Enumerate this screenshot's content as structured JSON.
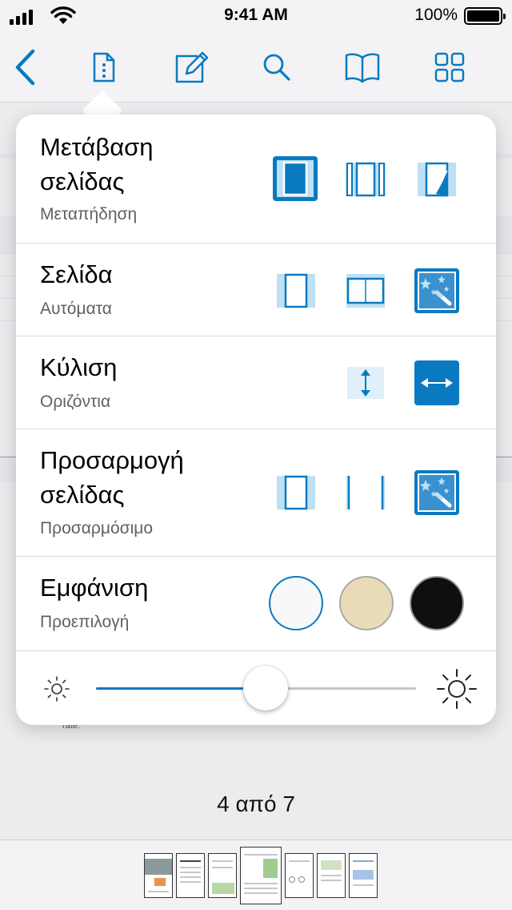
{
  "status_bar": {
    "time": "9:41 AM",
    "battery_percent": "100%",
    "battery_level": 1.0,
    "signal_bars": 4
  },
  "toolbar": {
    "items": [
      {
        "name": "back-chevron-icon"
      },
      {
        "name": "document-options-icon"
      },
      {
        "name": "annotate-pencil-icon"
      },
      {
        "name": "search-icon"
      },
      {
        "name": "bookmarks-book-icon"
      },
      {
        "name": "grid-view-icon"
      }
    ],
    "accent_color": "#0a7ac0"
  },
  "settings": {
    "transition": {
      "title_line1": "Μετάβαση",
      "title_line2": "σελίδας",
      "value": "Μεταπήδηση",
      "options": [
        "jump-transition-icon",
        "scroll-transition-icon",
        "curl-transition-icon"
      ],
      "selected_index": 0
    },
    "page": {
      "title": "Σελίδα",
      "value": "Αυτόματα",
      "options": [
        "single-page-icon",
        "double-page-icon",
        "automatic-magic-wand-icon"
      ],
      "selected_index": 2
    },
    "scroll": {
      "title": "Κύλιση",
      "value": "Οριζόντια",
      "options": [
        "vertical-scroll-icon",
        "horizontal-scroll-icon"
      ],
      "selected_index": 1
    },
    "fit": {
      "title_line1": "Προσαρμογή",
      "title_line2": "σελίδας",
      "value": "Προσαρμόσιμο",
      "options": [
        "fit-page-icon",
        "fit-width-icon",
        "adaptive-magic-wand-icon"
      ],
      "selected_index": 2
    },
    "appearance": {
      "title": "Εμφάνιση",
      "value": "Προεπιλογή",
      "themes": [
        {
          "name": "default-theme",
          "color": "#f8f8f8",
          "border": "#0a7ac0"
        },
        {
          "name": "sepia-theme",
          "color": "#eadbb8",
          "border": "#a9a9a9"
        },
        {
          "name": "night-theme",
          "color": "#0f0f0f",
          "border": "#9a9a9a"
        }
      ],
      "selected_index": 0
    },
    "brightness": {
      "level": 0.53
    }
  },
  "document": {
    "page_indicator": "4 από 7",
    "current_page": 4,
    "page_count": 7
  }
}
